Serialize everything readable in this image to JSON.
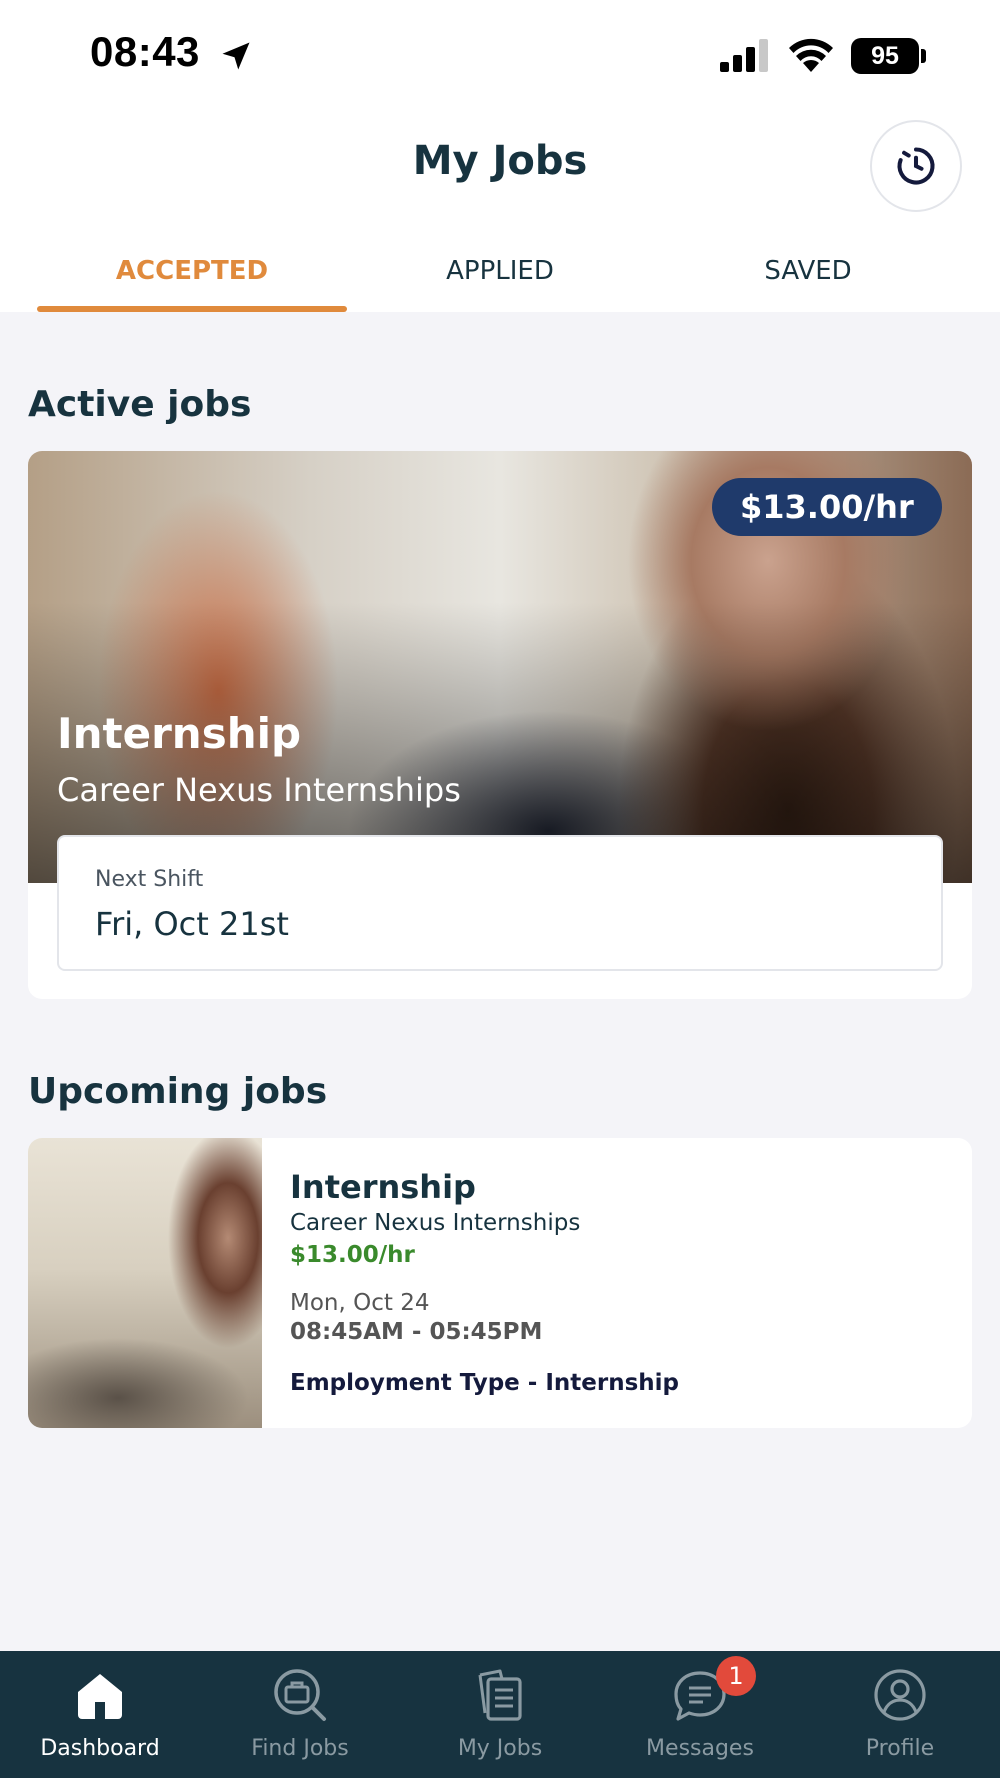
{
  "status_bar": {
    "time": "08:43",
    "battery": "95"
  },
  "header": {
    "title": "My Jobs"
  },
  "tabs": [
    {
      "label": "ACCEPTED",
      "active": true
    },
    {
      "label": "APPLIED",
      "active": false
    },
    {
      "label": "SAVED",
      "active": false
    }
  ],
  "active_jobs": {
    "section_title": "Active jobs",
    "job": {
      "rate": "$13.00/hr",
      "title": "Internship",
      "company": "Career Nexus Internships",
      "next_shift_label": "Next Shift",
      "next_shift_date": "Fri, Oct 21st"
    }
  },
  "upcoming_jobs": {
    "section_title": "Upcoming jobs",
    "job": {
      "title": "Internship",
      "company": "Career Nexus Internships",
      "rate": "$13.00/hr",
      "date": "Mon, Oct 24",
      "time": "08:45AM - 05:45PM",
      "employment_type": "Employment Type - Internship"
    }
  },
  "bottom_nav": [
    {
      "label": "Dashboard",
      "icon": "home-icon",
      "active": true
    },
    {
      "label": "Find Jobs",
      "icon": "briefcase-search-icon",
      "active": false
    },
    {
      "label": "My Jobs",
      "icon": "documents-icon",
      "active": false
    },
    {
      "label": "Messages",
      "icon": "chat-icon",
      "active": false,
      "badge": "1"
    },
    {
      "label": "Profile",
      "icon": "user-icon",
      "active": false
    }
  ],
  "colors": {
    "accent": "#e08a3c",
    "primary": "#17333f",
    "badge": "#1f3a6b",
    "rate_green": "#3a8a2c",
    "notification": "#e24a3b"
  }
}
